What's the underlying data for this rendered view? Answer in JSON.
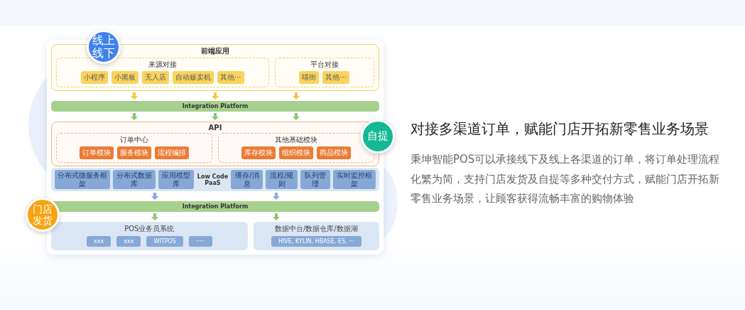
{
  "diagram": {
    "badges": [
      {
        "text": "线上线下",
        "color": "#3f82ec"
      },
      {
        "text": "自提",
        "color": "#14b894"
      },
      {
        "text": "门店发货",
        "color": "#f7a311"
      }
    ],
    "frontend": {
      "title": "前端应用",
      "groups": [
        {
          "title": "来源对接",
          "items": [
            "小程序",
            "小黑板",
            "无人店",
            "自动贩卖机",
            "其他···"
          ]
        },
        {
          "title": "平台对接",
          "items": [
            "喵街",
            "其他···"
          ]
        }
      ]
    },
    "integration_top": "Integration Platform",
    "api": {
      "title": "API",
      "groups": [
        {
          "title": "订单中心",
          "items": [
            "订单模块",
            "服务模块",
            "流程编排"
          ]
        },
        {
          "title": "其他基础模块",
          "items": [
            "库存模块",
            "组织模块",
            "商品模块"
          ]
        }
      ]
    },
    "infra": {
      "left": [
        "分布式微服务框架",
        "分布式数据库",
        "应用模型库"
      ],
      "label": "Low Code PaaS",
      "right": [
        "缓存/消息",
        "流程/规则",
        "队列管理",
        "实时监控框架"
      ]
    },
    "integration_bottom": "Integration Platform",
    "bottom": {
      "groups": [
        {
          "title": "POS业务员系统",
          "items": [
            "xxx",
            "xxx",
            "WITPOS",
            "·····"
          ]
        },
        {
          "title": "数据中台/数据仓库/数据湖",
          "items": [
            "HIVE, KYLIN, HBASE, ES, ···"
          ]
        }
      ]
    }
  },
  "heading": "对接多渠道订单，赋能门店开拓新零售业务场景",
  "description": "秉坤智能POS可以承接线下及线上各渠道的订单，将订单处理流程化繁为简，支持门店发货及自提等多种交付方式，赋能门店开拓新零售业务场景，让顾客获得流畅丰富的购物体验"
}
